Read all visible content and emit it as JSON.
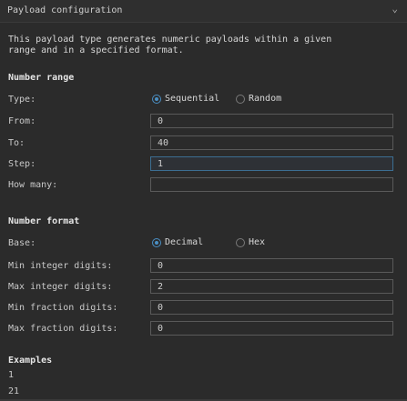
{
  "header": {
    "title": "Payload configuration",
    "chevron": "chevron-down-icon"
  },
  "description": {
    "line1": "This payload type generates numeric payloads within a given",
    "line2": "range and in a specified format."
  },
  "number_range": {
    "heading": "Number range",
    "type_label": "Type:",
    "type_options": [
      "Sequential",
      "Random"
    ],
    "type_selected": "Sequential",
    "from_label": "From:",
    "from_value": "0",
    "to_label": "To:",
    "to_value": "40",
    "step_label": "Step:",
    "step_value": "1",
    "howmany_label": "How many:",
    "howmany_value": ""
  },
  "number_format": {
    "heading": "Number format",
    "base_label": "Base:",
    "base_options": [
      "Decimal",
      "Hex"
    ],
    "base_selected": "Decimal",
    "min_int_label": "Min integer digits:",
    "min_int_value": "0",
    "max_int_label": "Max integer digits:",
    "max_int_value": "2",
    "min_frac_label": "Min fraction digits:",
    "min_frac_value": "0",
    "max_frac_label": "Max fraction digits:",
    "max_frac_value": "0"
  },
  "examples": {
    "heading": "Examples",
    "items": [
      "1",
      "21"
    ]
  },
  "colors": {
    "accent": "#4a8fc4",
    "background": "#2b2b2b",
    "focus_border": "#3c6e92"
  }
}
